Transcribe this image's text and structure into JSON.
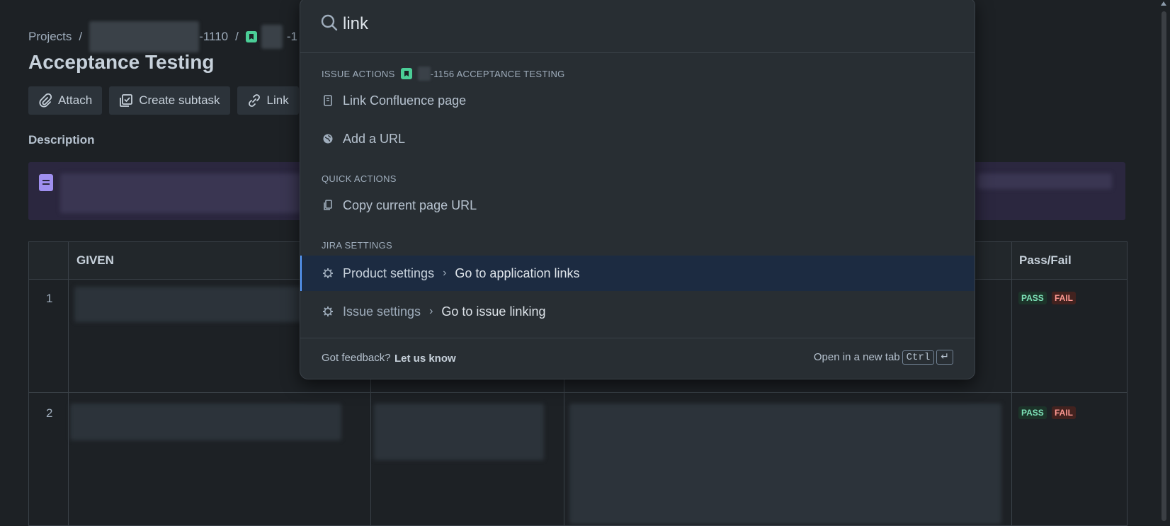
{
  "breadcrumb": {
    "projects": "Projects",
    "sep1": "/",
    "parent_suffix": "-1110",
    "sep2": "/",
    "issue_suffix": "-1"
  },
  "page": {
    "title": "Acceptance Testing",
    "description_label": "Description"
  },
  "toolbar": {
    "attach": "Attach",
    "create_subtask": "Create subtask",
    "link": "Link"
  },
  "table": {
    "headers": {
      "given": "GIVEN",
      "pass_fail": "Pass/Fail"
    },
    "rows": [
      {
        "num": "1",
        "pass": "PASS",
        "fail": "FAIL"
      },
      {
        "num": "2",
        "pass": "PASS",
        "fail": "FAIL"
      }
    ]
  },
  "search": {
    "value": "link",
    "sections": {
      "issue_actions": "ISSUE ACTIONS",
      "issue_key_suffix": "-1156 ACCEPTANCE TESTING",
      "quick_actions": "QUICK ACTIONS",
      "jira_settings": "JIRA SETTINGS"
    },
    "items": {
      "link_confluence": "Link Confluence page",
      "add_url": "Add a URL",
      "copy_url": "Copy current page URL",
      "product_settings": "Product settings",
      "go_app_links": "Go to application links",
      "issue_settings": "Issue settings",
      "go_issue_linking": "Go to issue linking"
    },
    "footer": {
      "feedback": "Got feedback?",
      "let_us_know": "Let us know",
      "open_new_tab": "Open in a new tab",
      "ctrl": "Ctrl",
      "enter": "↵"
    }
  },
  "colors": {
    "background": "#1d2125",
    "overlay": "#282e33",
    "selected": "#1c2b41",
    "story_green": "#4bce97",
    "pass": "#7ee2b8",
    "fail": "#fd9891"
  }
}
